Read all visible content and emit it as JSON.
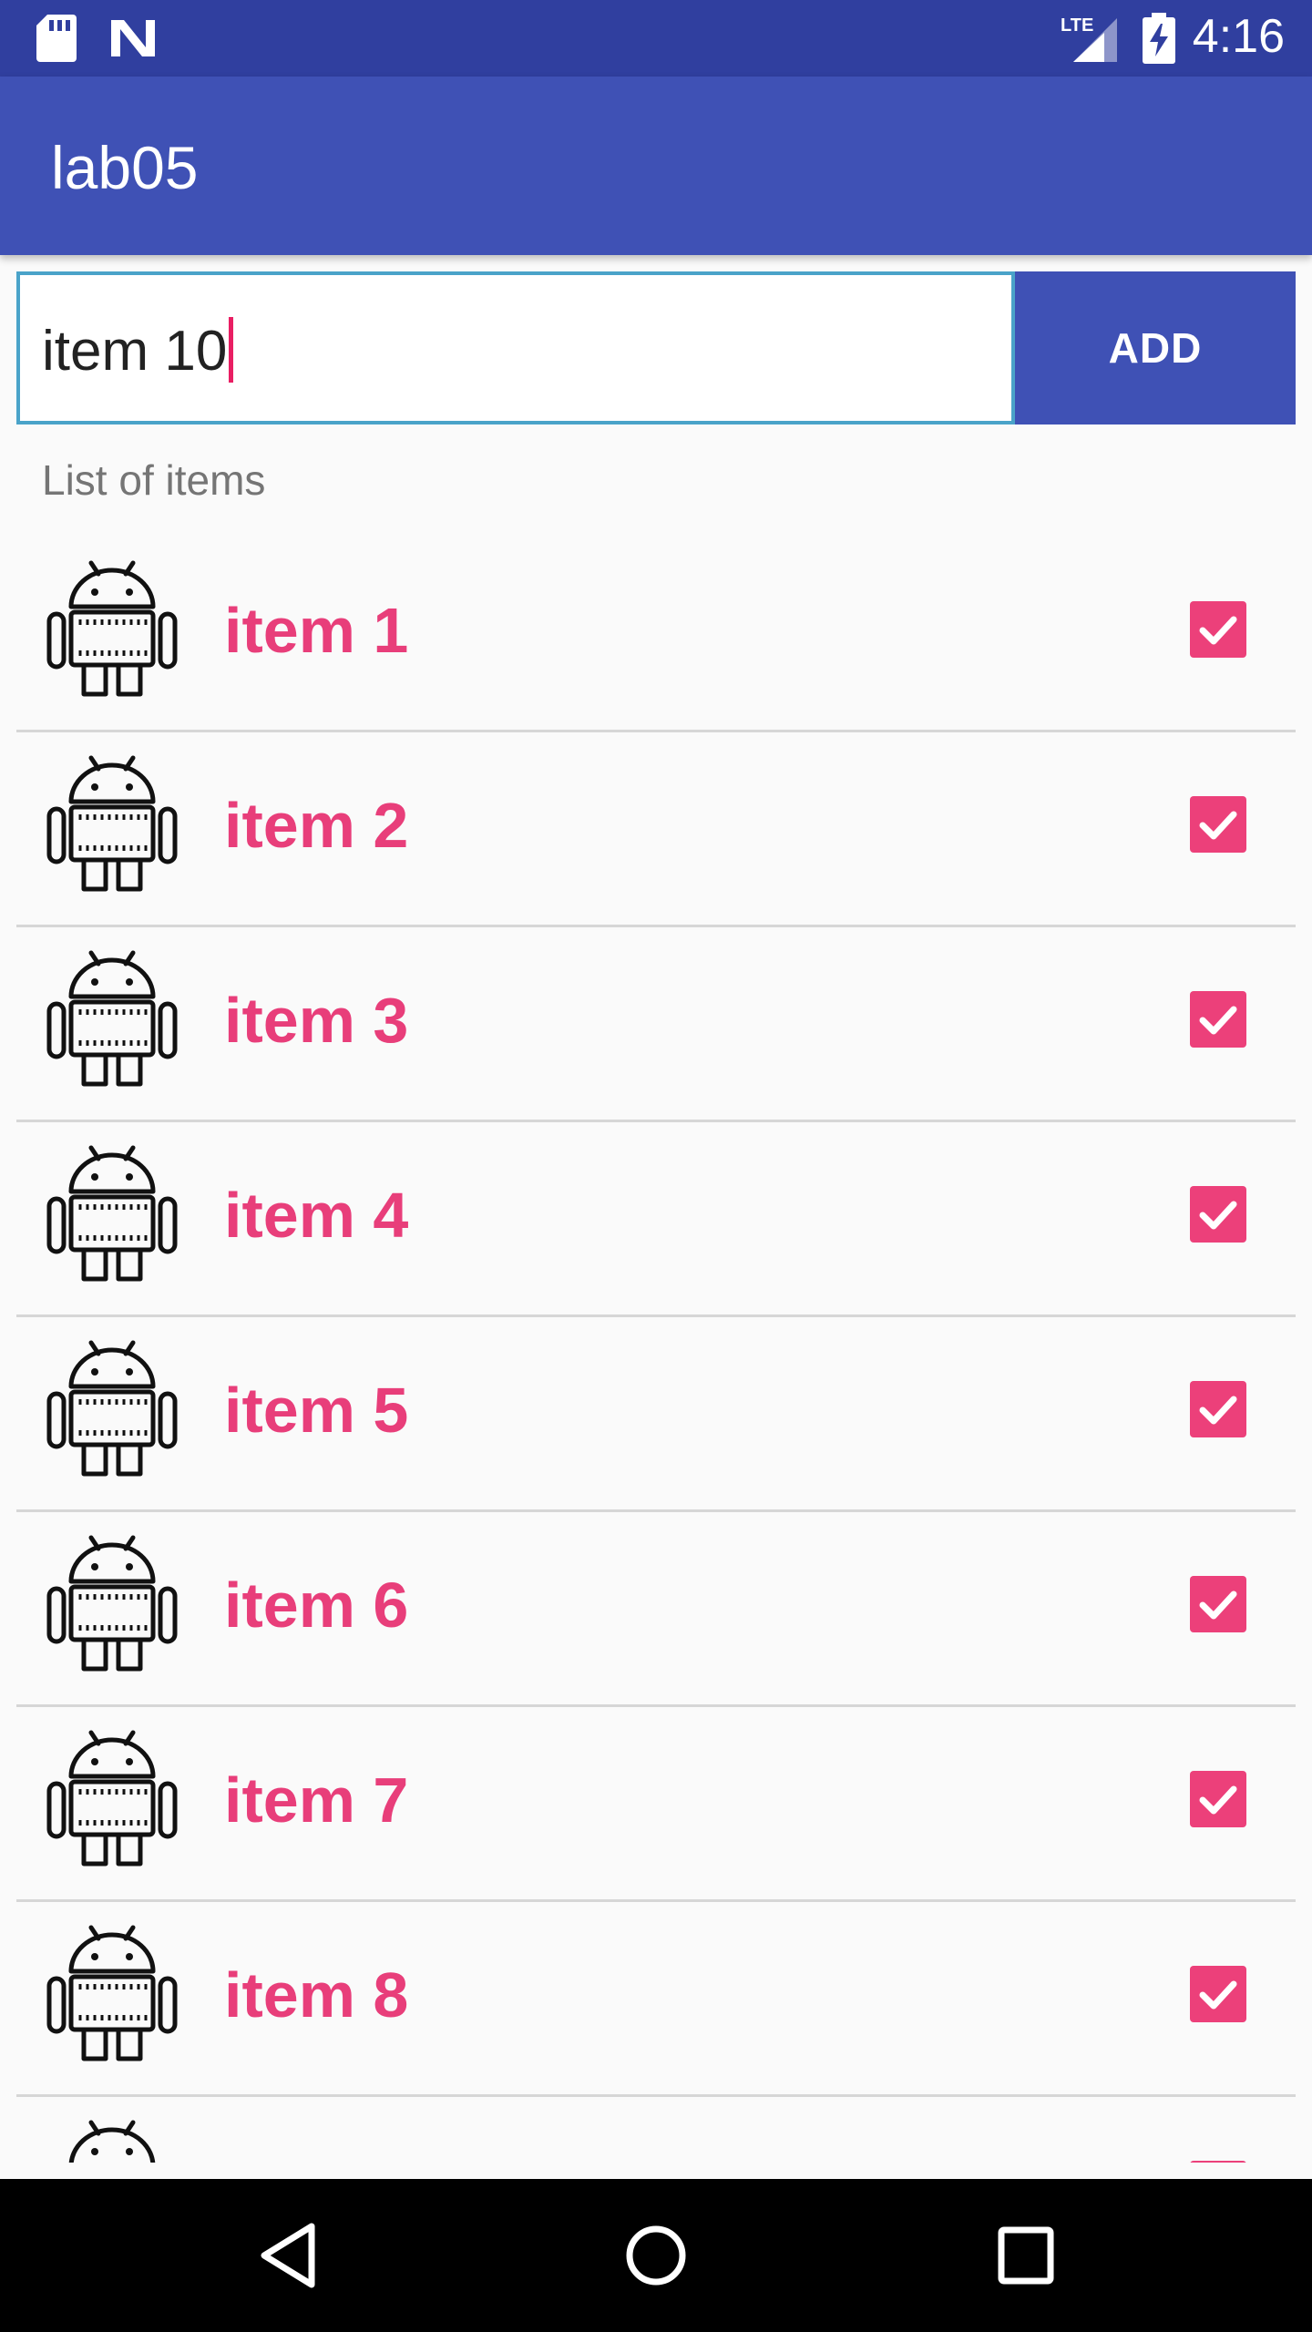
{
  "status_bar": {
    "time": "4:16",
    "icons": [
      "sd-card-icon",
      "n-notification-icon",
      "lte-signal-icon",
      "battery-charging-icon"
    ]
  },
  "app_bar": {
    "title": "lab05"
  },
  "input": {
    "value": "item 10"
  },
  "add_button": {
    "label": "ADD"
  },
  "list_header": "List of items",
  "items": [
    {
      "label": "item 1",
      "checked": true,
      "icon": "android-icon"
    },
    {
      "label": "item 2",
      "checked": true,
      "icon": "android-icon"
    },
    {
      "label": "item 3",
      "checked": true,
      "icon": "android-icon"
    },
    {
      "label": "item 4",
      "checked": true,
      "icon": "android-icon"
    },
    {
      "label": "item 5",
      "checked": true,
      "icon": "android-icon"
    },
    {
      "label": "item 6",
      "checked": true,
      "icon": "android-icon"
    },
    {
      "label": "item 7",
      "checked": true,
      "icon": "android-icon"
    },
    {
      "label": "item 8",
      "checked": true,
      "icon": "android-icon"
    },
    {
      "label": "",
      "checked": true,
      "icon": "android-icon"
    }
  ],
  "nav_bar": {
    "buttons": [
      "back-icon",
      "home-icon",
      "recents-icon"
    ]
  },
  "colors": {
    "status_bar": "#303f9f",
    "app_bar": "#3f51b5",
    "accent": "#ec407a",
    "item_text": "#e83e7a"
  }
}
